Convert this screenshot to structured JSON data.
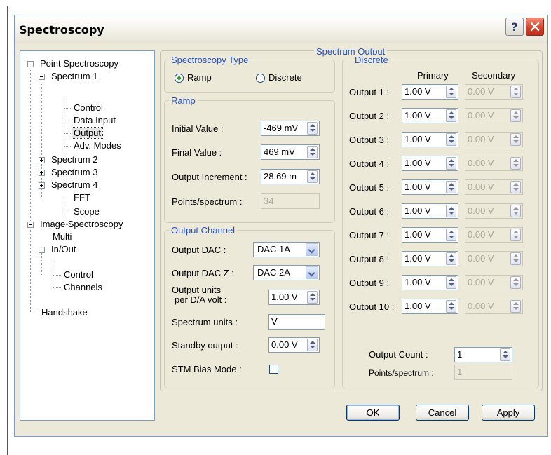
{
  "window": {
    "title": "Spectroscopy",
    "help_label": "?"
  },
  "tree": {
    "point_spectroscopy": "Point Spectroscopy",
    "spectrum1": "Spectrum  1",
    "control": "Control",
    "data_input": "Data Input",
    "output": "Output",
    "adv_modes": "Adv. Modes",
    "spectrum2": "Spectrum  2",
    "spectrum3": "Spectrum  3",
    "spectrum4": "Spectrum  4",
    "fft": "FFT",
    "scope": "Scope",
    "image_spectroscopy": "Image Spectroscopy",
    "multi": "Multi",
    "in_out": "In/Out",
    "io_control": "Control",
    "io_channels": "Channels",
    "handshake": "Handshake"
  },
  "spectrum_output": {
    "title": "Spectrum Output"
  },
  "spectroscopy_type": {
    "title": "Spectroscopy Type",
    "ramp": "Ramp",
    "discrete": "Discrete",
    "selected": "Ramp"
  },
  "ramp": {
    "title": "Ramp",
    "initial_label": "Initial Value :",
    "initial_value": "-469 mV",
    "final_label": "Final Value :",
    "final_value": "469 mV",
    "increment_label": "Output Increment :",
    "increment_value": "28.69 m",
    "points_label": "Points/spectrum :",
    "points_value": "34"
  },
  "output_channel": {
    "title": "Output Channel",
    "dac_label": "Output DAC :",
    "dac_value": "DAC 1A",
    "dacz_label": "Output DAC Z :",
    "dacz_value": "DAC 2A",
    "units_label_1": "Output units",
    "units_label_2": "per D/A volt :",
    "units_value": "1.00 V",
    "spectrum_units_label": "Spectrum units :",
    "spectrum_units_value": "V",
    "standby_label": "Standby output :",
    "standby_value": "0.00 V",
    "stm_label": "STM Bias Mode :",
    "stm_checked": false
  },
  "discrete": {
    "title": "Discrete",
    "primary_header": "Primary",
    "secondary_header": "Secondary",
    "rows": [
      {
        "label": "Output 1 :",
        "primary": "1.00 V",
        "secondary": "0.00 V"
      },
      {
        "label": "Output 2 :",
        "primary": "1.00 V",
        "secondary": "0.00 V"
      },
      {
        "label": "Output 3 :",
        "primary": "1.00 V",
        "secondary": "0.00 V"
      },
      {
        "label": "Output 4 :",
        "primary": "1.00 V",
        "secondary": "0.00 V"
      },
      {
        "label": "Output 5 :",
        "primary": "1.00 V",
        "secondary": "0.00 V"
      },
      {
        "label": "Output 6 :",
        "primary": "1.00 V",
        "secondary": "0.00 V"
      },
      {
        "label": "Output 7 :",
        "primary": "1.00 V",
        "secondary": "0.00 V"
      },
      {
        "label": "Output 8 :",
        "primary": "1.00 V",
        "secondary": "0.00 V"
      },
      {
        "label": "Output 9 :",
        "primary": "1.00 V",
        "secondary": "0.00 V"
      },
      {
        "label": "Output 10 :",
        "primary": "1.00 V",
        "secondary": "0.00 V"
      }
    ],
    "count_label": "Output Count :",
    "count_value": "1",
    "points_label": "Points/spectrum :",
    "points_value": "1"
  },
  "buttons": {
    "ok": "OK",
    "cancel": "Cancel",
    "apply": "Apply"
  }
}
